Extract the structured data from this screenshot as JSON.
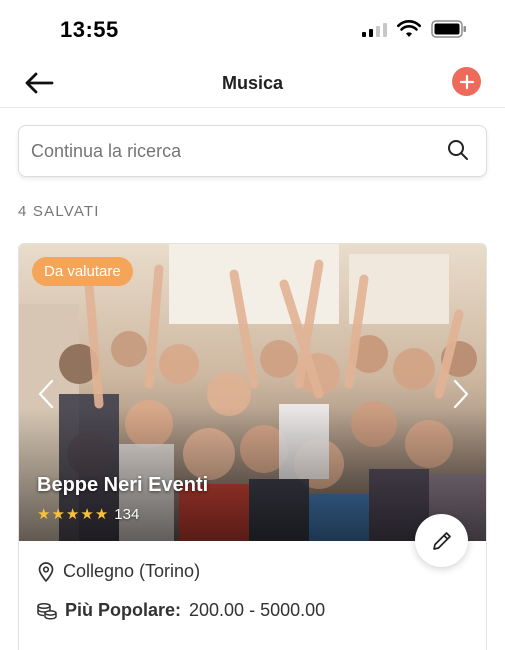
{
  "status": {
    "time": "13:55"
  },
  "header": {
    "title": "Musica"
  },
  "search": {
    "placeholder": "Continua la ricerca"
  },
  "saved": {
    "count_label": "4 SALVATI"
  },
  "card": {
    "badge": "Da valutare",
    "name": "Beppe Neri Eventi",
    "rating_stars": 5,
    "review_count": "134",
    "location": "Collegno (Torino)",
    "price_label": "Più Popolare:",
    "price_range": "200.00 - 5000.00"
  },
  "colors": {
    "accent": "#ee6a5b",
    "badge": "#f5a55a",
    "star": "#f7c23a"
  },
  "icons": [
    "back-arrow-icon",
    "plus-icon",
    "search-icon",
    "chevron-left-icon",
    "chevron-right-icon",
    "pencil-icon",
    "location-pin-icon",
    "coins-icon"
  ]
}
